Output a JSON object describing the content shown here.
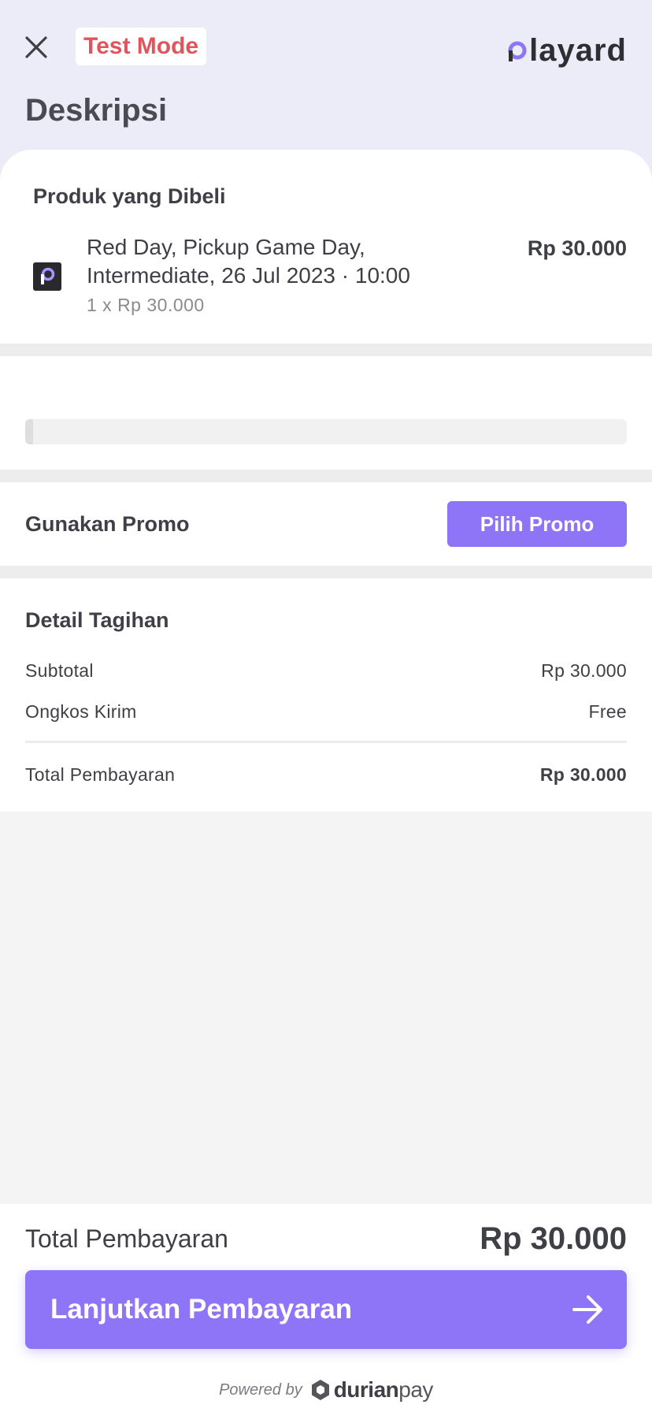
{
  "header": {
    "test_badge": "Test Mode",
    "brand_name": "layard",
    "brand_icon": "playard-p-logo-icon",
    "close_icon": "close-icon",
    "page_title": "Deskripsi"
  },
  "products": {
    "heading": "Produk yang Dibeli",
    "items": [
      {
        "name": "Red Day, Pickup Game Day, Intermediate, 26 Jul 2023 · 10:00",
        "quantity": "1 x Rp 30.000",
        "price": "Rp 30.000",
        "icon": "playard-logo-icon"
      }
    ]
  },
  "loading": {
    "progress": 0.013
  },
  "promo": {
    "label": "Gunakan Promo",
    "button": "Pilih Promo"
  },
  "bill": {
    "heading": "Detail Tagihan",
    "rows": [
      {
        "label": "Subtotal",
        "value": "Rp 30.000"
      },
      {
        "label": "Ongkos Kirim",
        "value": "Free"
      }
    ],
    "total": {
      "label": "Total Pembayaran",
      "value": "Rp 30.000"
    }
  },
  "footer": {
    "total_label": "Total Pembayaran",
    "total_value": "Rp 30.000",
    "cta_label": "Lanjutkan Pembayaran",
    "cta_icon": "arrow-right-icon",
    "powered_by": "Powered by",
    "provider_prefix": "durian",
    "provider_suffix": "pay",
    "provider_icon": "durianpay-logo-icon"
  },
  "colors": {
    "accent": "#8e75f7",
    "test_badge": "#e0555d",
    "header_bg": "#ecebf8"
  }
}
